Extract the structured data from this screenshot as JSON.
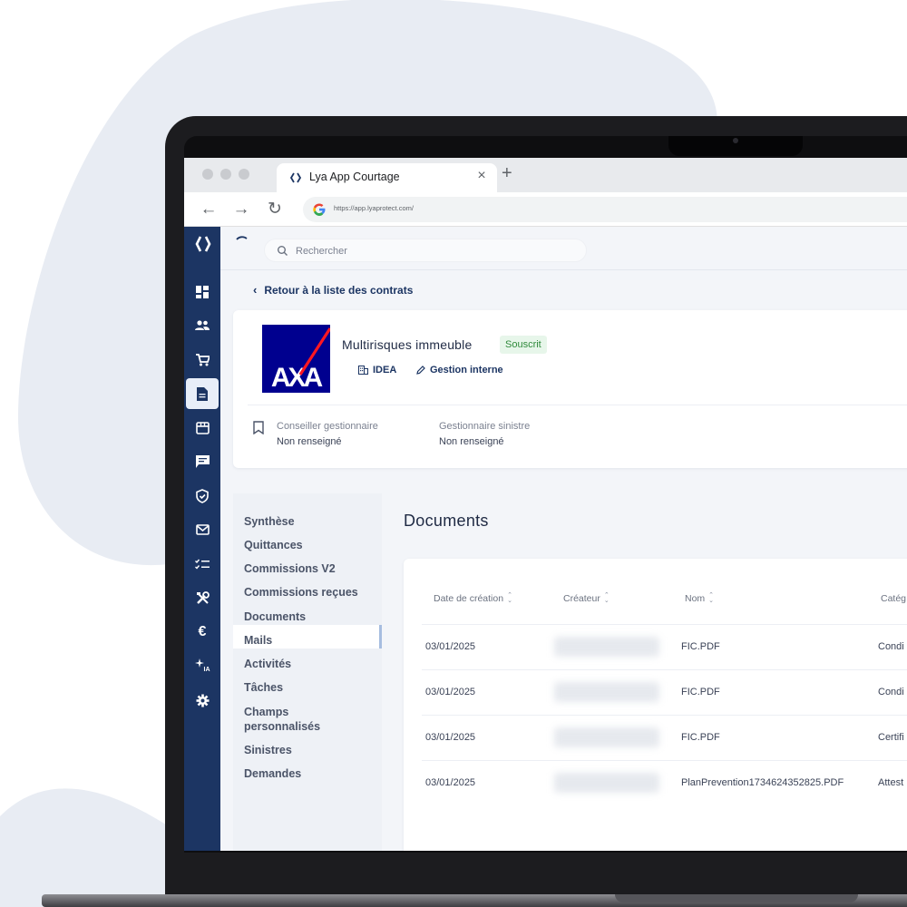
{
  "browser": {
    "tab_title": "Lya App Courtage",
    "tab_close": "×",
    "new_tab": "+",
    "url": "https://app.lyaprotect.com/",
    "nav": {
      "back": "←",
      "forward": "→",
      "reload": "↻"
    }
  },
  "sidebar": {
    "items": [
      {
        "icon": "dashboard-icon"
      },
      {
        "icon": "people-icon"
      },
      {
        "icon": "cart-icon"
      },
      {
        "icon": "document-icon",
        "active": true
      },
      {
        "icon": "store-icon"
      },
      {
        "icon": "message-icon"
      },
      {
        "icon": "shield-check-icon"
      },
      {
        "icon": "mail-icon"
      },
      {
        "icon": "checklist-icon"
      },
      {
        "icon": "tools-icon"
      },
      {
        "icon": "euro-icon",
        "glyph": "€"
      },
      {
        "icon": "ai-sparkle-icon",
        "glyph": "IA"
      },
      {
        "icon": "gear-icon"
      }
    ]
  },
  "search": {
    "placeholder": "Rechercher"
  },
  "back_link": "Retour à la liste des contrats",
  "contract": {
    "insurer_logo_text": "AXA",
    "title": "Multirisques immeuble",
    "status": "Souscrit",
    "status_color": "#2f8a3b",
    "chips": [
      {
        "icon": "building-icon",
        "label": "IDEA"
      },
      {
        "icon": "pencil-icon",
        "label": "Gestion interne"
      }
    ],
    "fields": [
      {
        "label": "Conseiller gestionnaire",
        "value": "Non renseigné"
      },
      {
        "label": "Gestionnaire sinistre",
        "value": "Non renseigné"
      }
    ]
  },
  "subnav": {
    "items": [
      "Synthèse",
      "Quittances",
      "Commissions V2",
      "Commissions reçues",
      "Documents",
      "Mails",
      "Activités",
      "Tâches",
      "Champs personnalisés",
      "Sinistres",
      "Demandes"
    ],
    "active": "Documents"
  },
  "documents": {
    "title": "Documents",
    "columns": [
      "Date de création",
      "Créateur",
      "Nom",
      "Catég"
    ],
    "rows": [
      {
        "date": "03/01/2025",
        "name": "FIC.PDF",
        "category": "Condi"
      },
      {
        "date": "03/01/2025",
        "name": "FIC.PDF",
        "category": "Condi"
      },
      {
        "date": "03/01/2025",
        "name": "FIC.PDF",
        "category": "Certifi"
      },
      {
        "date": "03/01/2025",
        "name": "PlanPrevention1734624352825.PDF",
        "category": "Attest"
      }
    ]
  },
  "colors": {
    "sidebar": "#1c3563",
    "accent": "#1c3563",
    "axa_blue": "#00008f",
    "axa_red": "#ff1721"
  }
}
